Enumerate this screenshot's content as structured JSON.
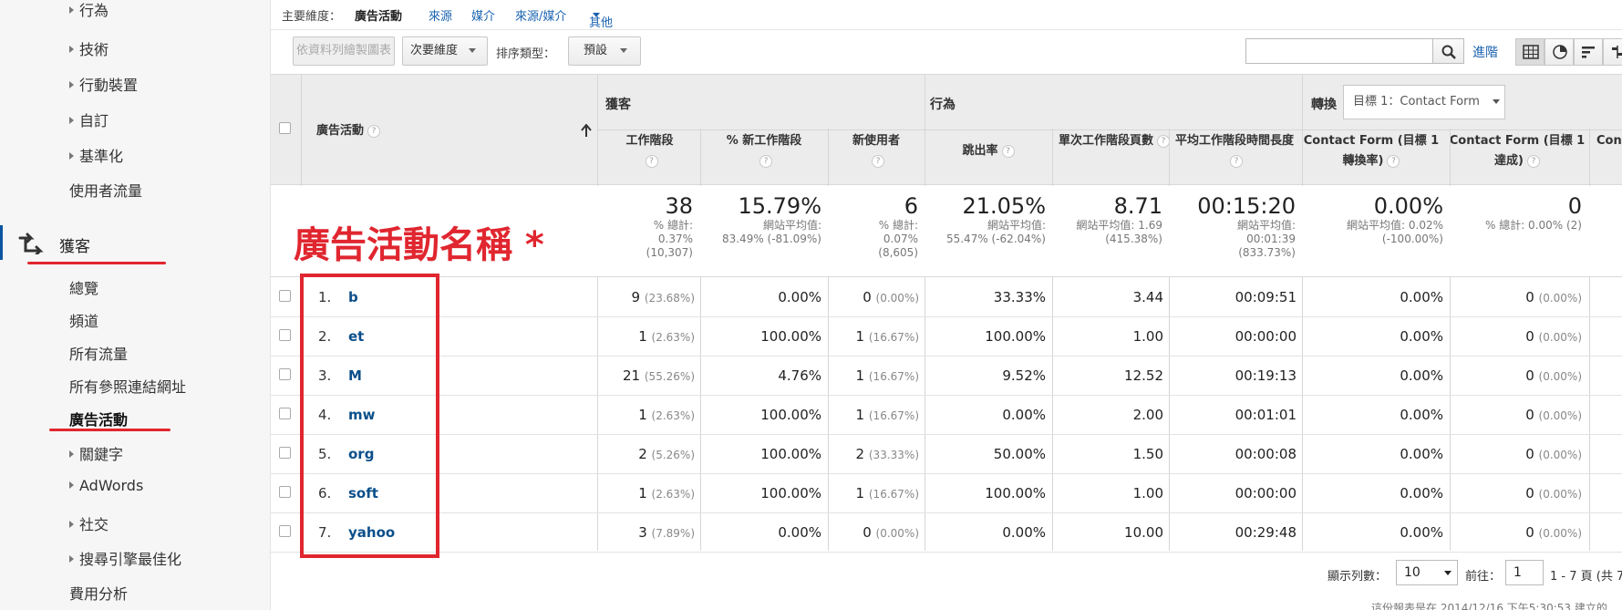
{
  "sidebar": {
    "items_top": [
      {
        "label": "行為",
        "arrow": true
      },
      {
        "label": "技術",
        "arrow": true
      },
      {
        "label": "行動裝置",
        "arrow": true
      },
      {
        "label": "自訂",
        "arrow": true
      },
      {
        "label": "基準化",
        "arrow": true
      },
      {
        "label": "使用者流量",
        "arrow": false
      }
    ],
    "section_label": "獲客",
    "items_acq": [
      {
        "label": "總覽",
        "arrow": false
      },
      {
        "label": "頻道",
        "arrow": false
      },
      {
        "label": "所有流量",
        "arrow": false
      },
      {
        "label": "所有參照連結網址",
        "arrow": false
      },
      {
        "label": "廣告活動",
        "arrow": false,
        "active": true
      },
      {
        "label": "關鍵字",
        "arrow": true
      },
      {
        "label": "AdWords",
        "arrow": true
      },
      {
        "label": "社交",
        "arrow": true
      },
      {
        "label": "搜尋引擎最佳化",
        "arrow": true
      },
      {
        "label": "費用分析",
        "arrow": false
      }
    ]
  },
  "dimbar": {
    "label": "主要維度：",
    "current": "廣告活動",
    "links": [
      "來源",
      "媒介",
      "來源/媒介",
      "其他"
    ]
  },
  "toolbar": {
    "plot_rows": "依資料列繪製圖表",
    "secondary_dim": "次要維度",
    "sort_label": "排序類型：",
    "sort_value": "預設",
    "search_placeholder": "",
    "advanced": "進階"
  },
  "table": {
    "group_acq": "獲客",
    "group_beh": "行為",
    "group_conv": "轉換",
    "conv_goal": "目標 1：Contact Form",
    "col_dim": "廣告活動",
    "columns": [
      "工作階段",
      "% 新工作階段",
      "新使用者",
      "跳出率",
      "單次工作階段頁數",
      "平均工作階段時間長度",
      "Contact Form (目標 1 轉換率)",
      "Contact Form (目標 1 達成)",
      "Con"
    ],
    "totals": [
      {
        "big": "38",
        "sub": [
          "% 總計:",
          "0.37%",
          "(10,307)"
        ]
      },
      {
        "big": "15.79%",
        "sub": [
          "網站平均值:",
          "83.49% (-81.09%)"
        ]
      },
      {
        "big": "6",
        "sub": [
          "% 總計:",
          "0.07%",
          "(8,605)"
        ]
      },
      {
        "big": "21.05%",
        "sub": [
          "網站平均值:",
          "55.47% (-62.04%)"
        ]
      },
      {
        "big": "8.71",
        "sub": [
          "網站平均值: 1.69",
          "(415.38%)"
        ]
      },
      {
        "big": "00:15:20",
        "sub": [
          "網站平均值:",
          "00:01:39",
          "(833.73%)"
        ]
      },
      {
        "big": "0.00%",
        "sub": [
          "網站平均值: 0.02%",
          "(-100.00%)"
        ]
      },
      {
        "big": "0",
        "sub": [
          "% 總計: 0.00% (2)"
        ]
      }
    ],
    "rows": [
      {
        "idx": "1.",
        "name": "b",
        "sessions": "9",
        "sessions_pct": "(23.68%)",
        "new_sess": "0.00%",
        "new_users": "0",
        "new_users_pct": "(0.00%)",
        "bounce": "33.33%",
        "pages": "3.44",
        "duration": "00:09:51",
        "conv_rate": "0.00%",
        "goal": "0",
        "goal_pct": "(0.00%)"
      },
      {
        "idx": "2.",
        "name": "et",
        "sessions": "1",
        "sessions_pct": "(2.63%)",
        "new_sess": "100.00%",
        "new_users": "1",
        "new_users_pct": "(16.67%)",
        "bounce": "100.00%",
        "pages": "1.00",
        "duration": "00:00:00",
        "conv_rate": "0.00%",
        "goal": "0",
        "goal_pct": "(0.00%)"
      },
      {
        "idx": "3.",
        "name": "M",
        "sessions": "21",
        "sessions_pct": "(55.26%)",
        "new_sess": "4.76%",
        "new_users": "1",
        "new_users_pct": "(16.67%)",
        "bounce": "9.52%",
        "pages": "12.52",
        "duration": "00:19:13",
        "conv_rate": "0.00%",
        "goal": "0",
        "goal_pct": "(0.00%)"
      },
      {
        "idx": "4.",
        "name": "mw",
        "sessions": "1",
        "sessions_pct": "(2.63%)",
        "new_sess": "100.00%",
        "new_users": "1",
        "new_users_pct": "(16.67%)",
        "bounce": "0.00%",
        "pages": "2.00",
        "duration": "00:01:01",
        "conv_rate": "0.00%",
        "goal": "0",
        "goal_pct": "(0.00%)"
      },
      {
        "idx": "5.",
        "name": "org",
        "sessions": "2",
        "sessions_pct": "(5.26%)",
        "new_sess": "100.00%",
        "new_users": "2",
        "new_users_pct": "(33.33%)",
        "bounce": "50.00%",
        "pages": "1.50",
        "duration": "00:00:08",
        "conv_rate": "0.00%",
        "goal": "0",
        "goal_pct": "(0.00%)"
      },
      {
        "idx": "6.",
        "name": "soft",
        "sessions": "1",
        "sessions_pct": "(2.63%)",
        "new_sess": "100.00%",
        "new_users": "1",
        "new_users_pct": "(16.67%)",
        "bounce": "100.00%",
        "pages": "1.00",
        "duration": "00:00:00",
        "conv_rate": "0.00%",
        "goal": "0",
        "goal_pct": "(0.00%)"
      },
      {
        "idx": "7.",
        "name": "yahoo",
        "sessions": "3",
        "sessions_pct": "(7.89%)",
        "new_sess": "0.00%",
        "new_users": "0",
        "new_users_pct": "(0.00%)",
        "bounce": "0.00%",
        "pages": "10.00",
        "duration": "00:29:48",
        "conv_rate": "0.00%",
        "goal": "0",
        "goal_pct": "(0.00%)"
      }
    ]
  },
  "annotation": "廣告活動名稱 *",
  "footer": {
    "rows_label": "顯示列數：",
    "rows_value": "10",
    "goto_label": "前往：",
    "goto_value": "1",
    "range": "1 - 7 頁 (共 7",
    "created": "這份報表是在 2014/12/16 下午5:30:53 建立的"
  },
  "colors": {
    "accent": "#0b55a0",
    "link": "#1a63b0",
    "annotation": "#e0262f"
  }
}
